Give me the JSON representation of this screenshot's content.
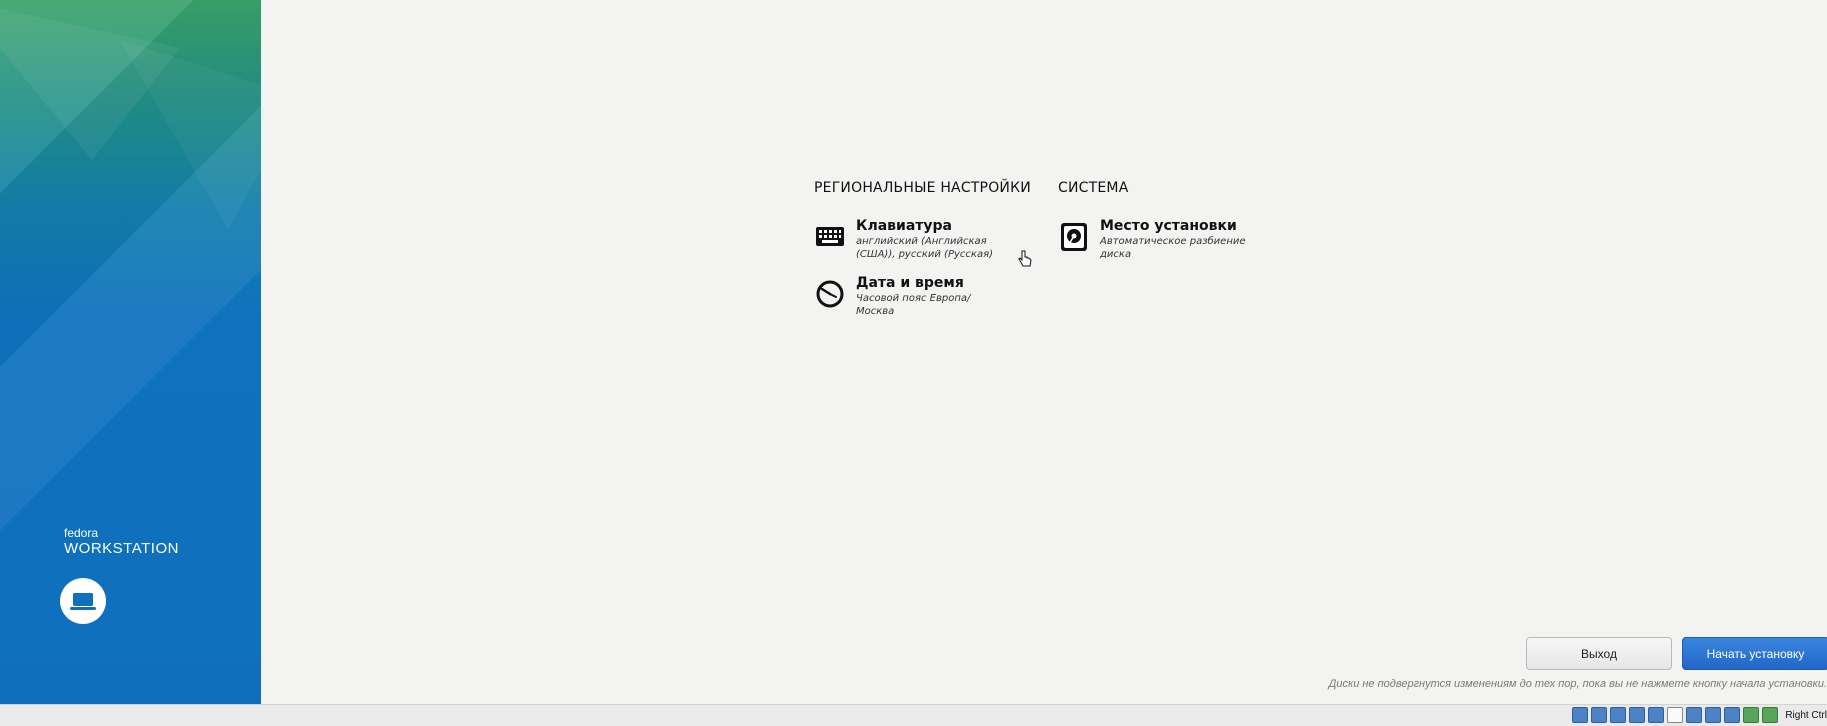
{
  "sidebar": {
    "brand_small": "fedora",
    "brand_big": "WORKSTATION",
    "brand_icon": "laptop-icon",
    "gradient_colors": [
      "#3aa36a",
      "#137fae",
      "#0f6fbd"
    ]
  },
  "hub": {
    "regional": {
      "heading": "РЕГИОНАЛЬНЫЕ НАСТРОЙКИ",
      "items": [
        {
          "title": "Клавиатура",
          "status": "английский (Английская (США)), русский (Русская)",
          "icon": "keyboard-icon"
        },
        {
          "title": "Дата и время",
          "status": "Часовой пояс Европа/Москва",
          "icon": "clock-icon"
        }
      ]
    },
    "system": {
      "heading": "СИСТЕМА",
      "items": [
        {
          "title": "Место установки",
          "status": "Автоматическое разбиение диска",
          "icon": "disk-icon"
        }
      ]
    }
  },
  "footer": {
    "quit_label": "Выход",
    "begin_label": "Начать установку",
    "note": "Диски не подвергнутся изменениям до тех пор, пока вы не нажмете кнопку начала установки."
  },
  "statusbar": {
    "host_key": "Right Ctrl"
  },
  "colors": {
    "background": "#f3f3f2",
    "primary_button": "#2a73d6"
  }
}
